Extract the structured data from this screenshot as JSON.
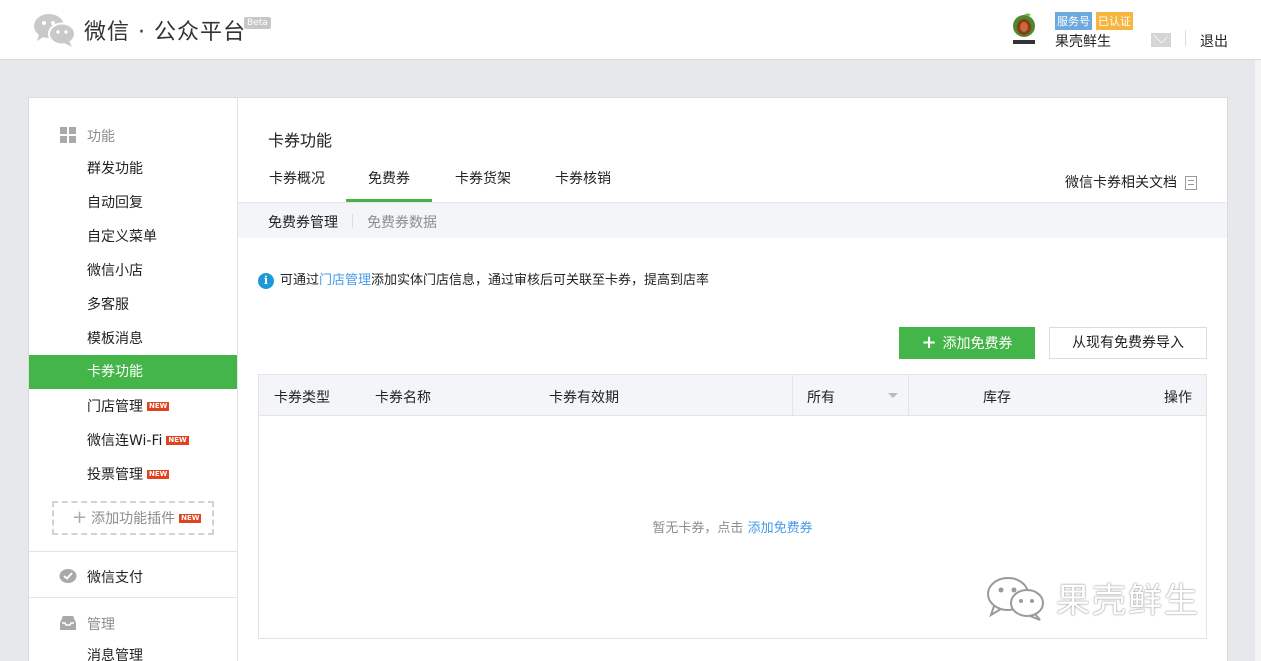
{
  "header": {
    "brand": "微信 · 公众平台",
    "beta": "Beta",
    "account_type": "服务号",
    "verified": "已认证",
    "account_name": "果壳鲜生",
    "logout": "退出"
  },
  "sidebar": {
    "section_function": "功能",
    "items": [
      {
        "label": "群发功能"
      },
      {
        "label": "自动回复"
      },
      {
        "label": "自定义菜单"
      },
      {
        "label": "微信小店"
      },
      {
        "label": "多客服"
      },
      {
        "label": "模板消息"
      },
      {
        "label": "卡券功能"
      },
      {
        "label": "门店管理"
      },
      {
        "label": "微信连Wi-Fi"
      },
      {
        "label": "投票管理"
      }
    ],
    "active_index": 6,
    "new_badge": "NEW",
    "add_plugin": "添加功能插件",
    "section_pay": "微信支付",
    "section_manage": "管理",
    "manage_first_item": "消息管理"
  },
  "main": {
    "title": "卡券功能",
    "tabs": [
      {
        "label": "卡券概况"
      },
      {
        "label": "免费券"
      },
      {
        "label": "卡券货架"
      },
      {
        "label": "卡券核销"
      }
    ],
    "active_tab": 1,
    "docs_link": "微信卡券相关文档",
    "subtabs": [
      {
        "label": "免费券管理"
      },
      {
        "label": "免费券数据"
      }
    ],
    "notice_prefix": "可通过",
    "notice_link": "门店管理",
    "notice_suffix": "添加实体门店信息，通过审核后可关联至卡券，提高到店率",
    "add_button": "添加免费券",
    "import_button": "从现有免费券导入",
    "table": {
      "columns": [
        "卡券类型",
        "卡券名称",
        "卡券有效期",
        "库存",
        "操作"
      ],
      "filter_value": "所有",
      "empty_text": "暂无卡券，点击",
      "empty_link": "添加免费券"
    }
  },
  "watermark": "果壳鲜生",
  "colors": {
    "accent_green": "#44b549",
    "link_blue": "#459ae9",
    "badge_red": "#e0431d"
  }
}
